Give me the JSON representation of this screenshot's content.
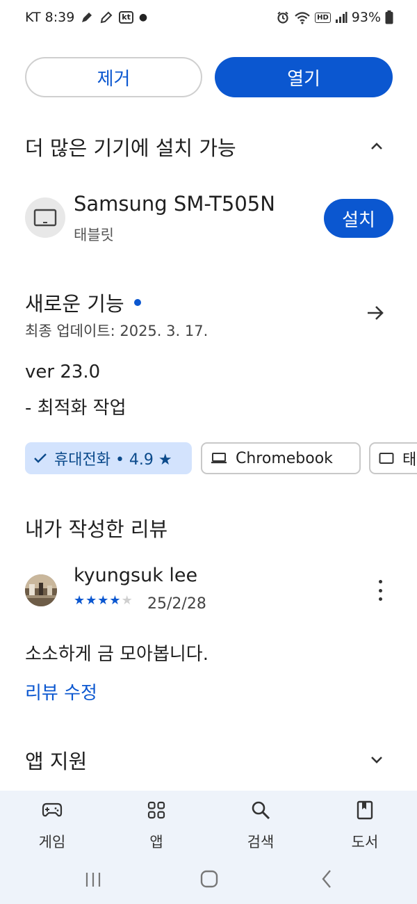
{
  "status_bar": {
    "carrier_time": "KT 8:39",
    "kt_label": "kt",
    "hd_label": "HD",
    "battery": "93%"
  },
  "top_actions": {
    "remove_label": "제거",
    "open_label": "열기"
  },
  "more_devices": {
    "title": "더 많은 기기에 설치 가능",
    "device_name": "Samsung SM-T505N",
    "device_type": "태블릿",
    "install_label": "설치"
  },
  "whats_new": {
    "title": "새로운 기능",
    "updated": "최종 업데이트: 2025. 3. 17.",
    "version": "ver 23.0",
    "note": "- 최적화 작업"
  },
  "chips": {
    "phone_label": "휴대전화 • 4.9 ★",
    "chromebook_label": "Chromebook",
    "tablet_label": "태"
  },
  "my_review": {
    "title": "내가 작성한 리뷰",
    "reviewer": "kyungsuk lee",
    "rating": 4,
    "max_rating": 5,
    "date": "25/2/28",
    "text": "소소하게 금 모아봅니다.",
    "edit_label": "리뷰 수정"
  },
  "app_support": {
    "title": "앱 지원"
  },
  "bottom_nav": {
    "games": "게임",
    "apps": "앱",
    "search": "검색",
    "books": "도서"
  },
  "colors": {
    "accent": "#0b57d0",
    "chip_selected": "#d3e3fd",
    "nav_bg": "#eef3fa"
  }
}
